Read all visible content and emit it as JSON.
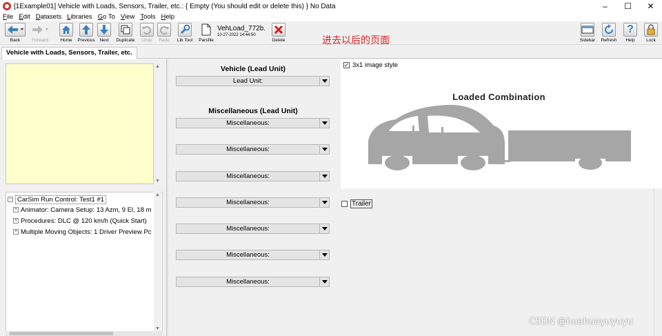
{
  "window": {
    "title": "[1Example01] Vehicle with Loads, Sensors, Trailer, etc.: { Empty (You should edit or delete this) } No Data",
    "minimize": "–",
    "maximize": "☐",
    "close": "✕"
  },
  "menu": [
    "File",
    "Edit",
    "Datasets",
    "Libraries",
    "Go To",
    "View",
    "Tools",
    "Help"
  ],
  "toolbar": {
    "back": "Back",
    "forward": "Forward",
    "home": "Home",
    "previous": "Previous",
    "next": "Next",
    "duplicate": "Duplicate",
    "undo": "Undo",
    "redo": "Redo",
    "lib_tool": "Lib Tool",
    "parsfile": "Parsfile",
    "dataset_name": "VehLoad_772b.",
    "dataset_date": "10-27-2022 14:44:50",
    "delete": "Delete",
    "sidebar": "Sidebar",
    "refresh": "Refresh",
    "help": "Help",
    "lock": "Lock"
  },
  "annotation_text": "进去以后的页面",
  "tab": {
    "label": "Vehicle with Loads, Sensors, Trailer, etc."
  },
  "tree": {
    "root": "CarSim Run Control: Test1 #1",
    "children": [
      "Animator: Camera Setup: 13 Azm, 9 El, 18 m",
      "Procedures: DLC @ 120 km/h (Quick Start)",
      "Multiple Moving Objects: 1 Driver Preview Pc"
    ]
  },
  "vehicle": {
    "title": "Vehicle (Lead Unit)",
    "lead_unit": "Lead Unit:"
  },
  "misc": {
    "title": "Miscellaneous (Lead Unit)",
    "items": [
      "Miscellaneous:",
      "Miscellaneous:",
      "Miscellaneous:",
      "Miscellaneous:",
      "Miscellaneous:",
      "Miscellaneous:",
      "Miscellaneous:"
    ]
  },
  "image_panel": {
    "style_checkbox": "3x1 image style",
    "style_checked": true,
    "title": "Loaded Combination",
    "trailer_checkbox": "Trailer",
    "trailer_checked": false
  },
  "watermark": "CSDN @huahuayuyuyu",
  "colors": {
    "notes_bg": "#ffffcc",
    "annotation": "#e02020",
    "vehicle_gray": "#a6a6a6"
  }
}
